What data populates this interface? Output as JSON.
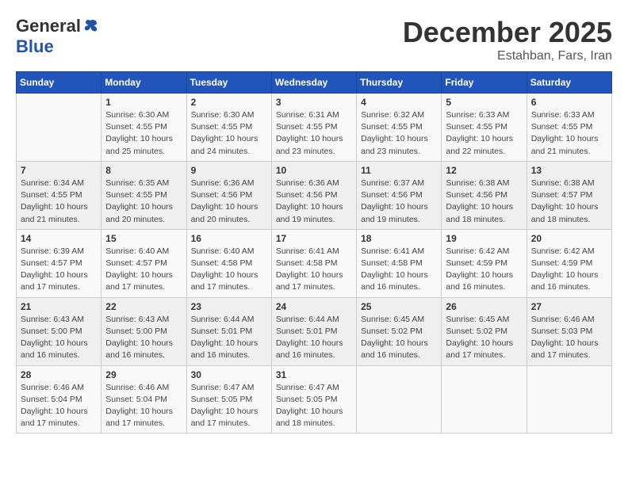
{
  "header": {
    "logo_general": "General",
    "logo_blue": "Blue",
    "month_title": "December 2025",
    "subtitle": "Estahban, Fars, Iran"
  },
  "days_of_week": [
    "Sunday",
    "Monday",
    "Tuesday",
    "Wednesday",
    "Thursday",
    "Friday",
    "Saturday"
  ],
  "weeks": [
    [
      {
        "day": "",
        "info": ""
      },
      {
        "day": "1",
        "info": "Sunrise: 6:30 AM\nSunset: 4:55 PM\nDaylight: 10 hours and 25 minutes."
      },
      {
        "day": "2",
        "info": "Sunrise: 6:30 AM\nSunset: 4:55 PM\nDaylight: 10 hours and 24 minutes."
      },
      {
        "day": "3",
        "info": "Sunrise: 6:31 AM\nSunset: 4:55 PM\nDaylight: 10 hours and 23 minutes."
      },
      {
        "day": "4",
        "info": "Sunrise: 6:32 AM\nSunset: 4:55 PM\nDaylight: 10 hours and 23 minutes."
      },
      {
        "day": "5",
        "info": "Sunrise: 6:33 AM\nSunset: 4:55 PM\nDaylight: 10 hours and 22 minutes."
      },
      {
        "day": "6",
        "info": "Sunrise: 6:33 AM\nSunset: 4:55 PM\nDaylight: 10 hours and 21 minutes."
      }
    ],
    [
      {
        "day": "7",
        "info": "Sunrise: 6:34 AM\nSunset: 4:55 PM\nDaylight: 10 hours and 21 minutes."
      },
      {
        "day": "8",
        "info": "Sunrise: 6:35 AM\nSunset: 4:55 PM\nDaylight: 10 hours and 20 minutes."
      },
      {
        "day": "9",
        "info": "Sunrise: 6:36 AM\nSunset: 4:56 PM\nDaylight: 10 hours and 20 minutes."
      },
      {
        "day": "10",
        "info": "Sunrise: 6:36 AM\nSunset: 4:56 PM\nDaylight: 10 hours and 19 minutes."
      },
      {
        "day": "11",
        "info": "Sunrise: 6:37 AM\nSunset: 4:56 PM\nDaylight: 10 hours and 19 minutes."
      },
      {
        "day": "12",
        "info": "Sunrise: 6:38 AM\nSunset: 4:56 PM\nDaylight: 10 hours and 18 minutes."
      },
      {
        "day": "13",
        "info": "Sunrise: 6:38 AM\nSunset: 4:57 PM\nDaylight: 10 hours and 18 minutes."
      }
    ],
    [
      {
        "day": "14",
        "info": "Sunrise: 6:39 AM\nSunset: 4:57 PM\nDaylight: 10 hours and 17 minutes."
      },
      {
        "day": "15",
        "info": "Sunrise: 6:40 AM\nSunset: 4:57 PM\nDaylight: 10 hours and 17 minutes."
      },
      {
        "day": "16",
        "info": "Sunrise: 6:40 AM\nSunset: 4:58 PM\nDaylight: 10 hours and 17 minutes."
      },
      {
        "day": "17",
        "info": "Sunrise: 6:41 AM\nSunset: 4:58 PM\nDaylight: 10 hours and 17 minutes."
      },
      {
        "day": "18",
        "info": "Sunrise: 6:41 AM\nSunset: 4:58 PM\nDaylight: 10 hours and 16 minutes."
      },
      {
        "day": "19",
        "info": "Sunrise: 6:42 AM\nSunset: 4:59 PM\nDaylight: 10 hours and 16 minutes."
      },
      {
        "day": "20",
        "info": "Sunrise: 6:42 AM\nSunset: 4:59 PM\nDaylight: 10 hours and 16 minutes."
      }
    ],
    [
      {
        "day": "21",
        "info": "Sunrise: 6:43 AM\nSunset: 5:00 PM\nDaylight: 10 hours and 16 minutes."
      },
      {
        "day": "22",
        "info": "Sunrise: 6:43 AM\nSunset: 5:00 PM\nDaylight: 10 hours and 16 minutes."
      },
      {
        "day": "23",
        "info": "Sunrise: 6:44 AM\nSunset: 5:01 PM\nDaylight: 10 hours and 16 minutes."
      },
      {
        "day": "24",
        "info": "Sunrise: 6:44 AM\nSunset: 5:01 PM\nDaylight: 10 hours and 16 minutes."
      },
      {
        "day": "25",
        "info": "Sunrise: 6:45 AM\nSunset: 5:02 PM\nDaylight: 10 hours and 16 minutes."
      },
      {
        "day": "26",
        "info": "Sunrise: 6:45 AM\nSunset: 5:02 PM\nDaylight: 10 hours and 17 minutes."
      },
      {
        "day": "27",
        "info": "Sunrise: 6:46 AM\nSunset: 5:03 PM\nDaylight: 10 hours and 17 minutes."
      }
    ],
    [
      {
        "day": "28",
        "info": "Sunrise: 6:46 AM\nSunset: 5:04 PM\nDaylight: 10 hours and 17 minutes."
      },
      {
        "day": "29",
        "info": "Sunrise: 6:46 AM\nSunset: 5:04 PM\nDaylight: 10 hours and 17 minutes."
      },
      {
        "day": "30",
        "info": "Sunrise: 6:47 AM\nSunset: 5:05 PM\nDaylight: 10 hours and 17 minutes."
      },
      {
        "day": "31",
        "info": "Sunrise: 6:47 AM\nSunset: 5:05 PM\nDaylight: 10 hours and 18 minutes."
      },
      {
        "day": "",
        "info": ""
      },
      {
        "day": "",
        "info": ""
      },
      {
        "day": "",
        "info": ""
      }
    ]
  ]
}
